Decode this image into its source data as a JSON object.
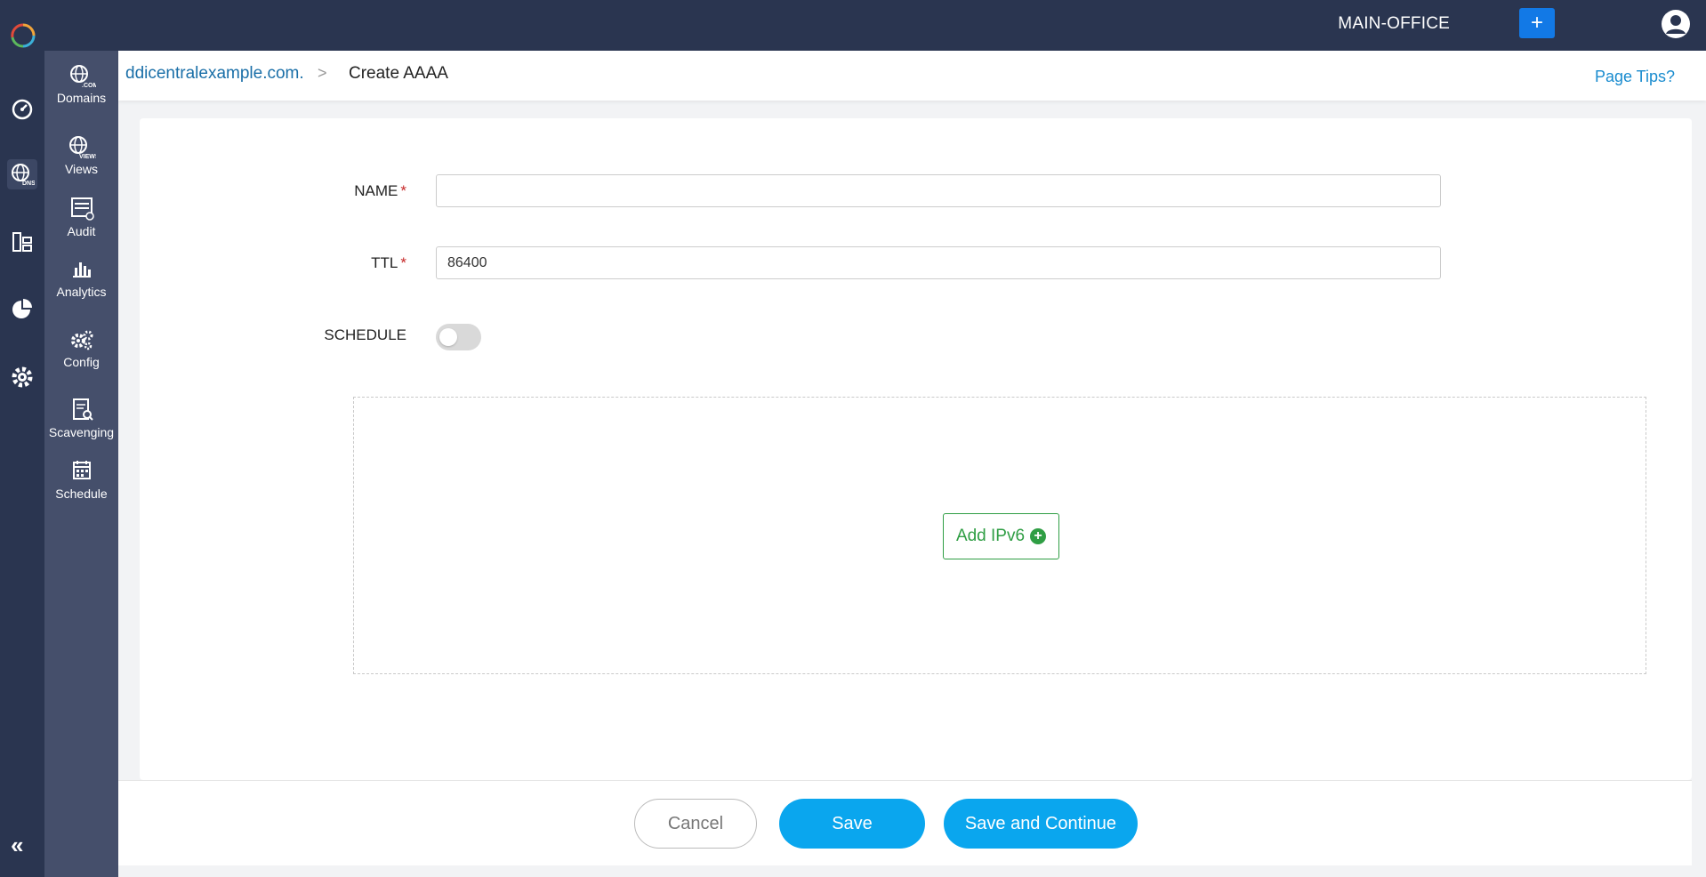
{
  "topbar": {
    "org": "MAIN-OFFICE",
    "add_label": "+"
  },
  "rail": {
    "collapse_label": "«"
  },
  "subnav": {
    "items": [
      {
        "label": "Domains"
      },
      {
        "label": "Views"
      },
      {
        "label": "Audit"
      },
      {
        "label": "Analytics"
      },
      {
        "label": "Config"
      },
      {
        "label": "Scavenging"
      },
      {
        "label": "Schedule"
      }
    ]
  },
  "breadcrumb": {
    "parent": "ddicentralexample.com.",
    "separator": ">",
    "current": "Create AAAA"
  },
  "header": {
    "page_tips": "Page Tips?"
  },
  "form": {
    "name_label": "NAME",
    "name_value": "",
    "ttl_label": "TTL",
    "ttl_value": "86400",
    "required_mark": "*",
    "schedule_label": "SCHEDULE",
    "add_ipv6_label": "Add IPv6"
  },
  "footer": {
    "cancel": "Cancel",
    "save": "Save",
    "save_continue": "Save and Continue"
  },
  "colors": {
    "topbar": "#2a3550",
    "subnav": "#454f6b",
    "primary": "#0aa6ee",
    "add_green": "#2f9e44"
  }
}
